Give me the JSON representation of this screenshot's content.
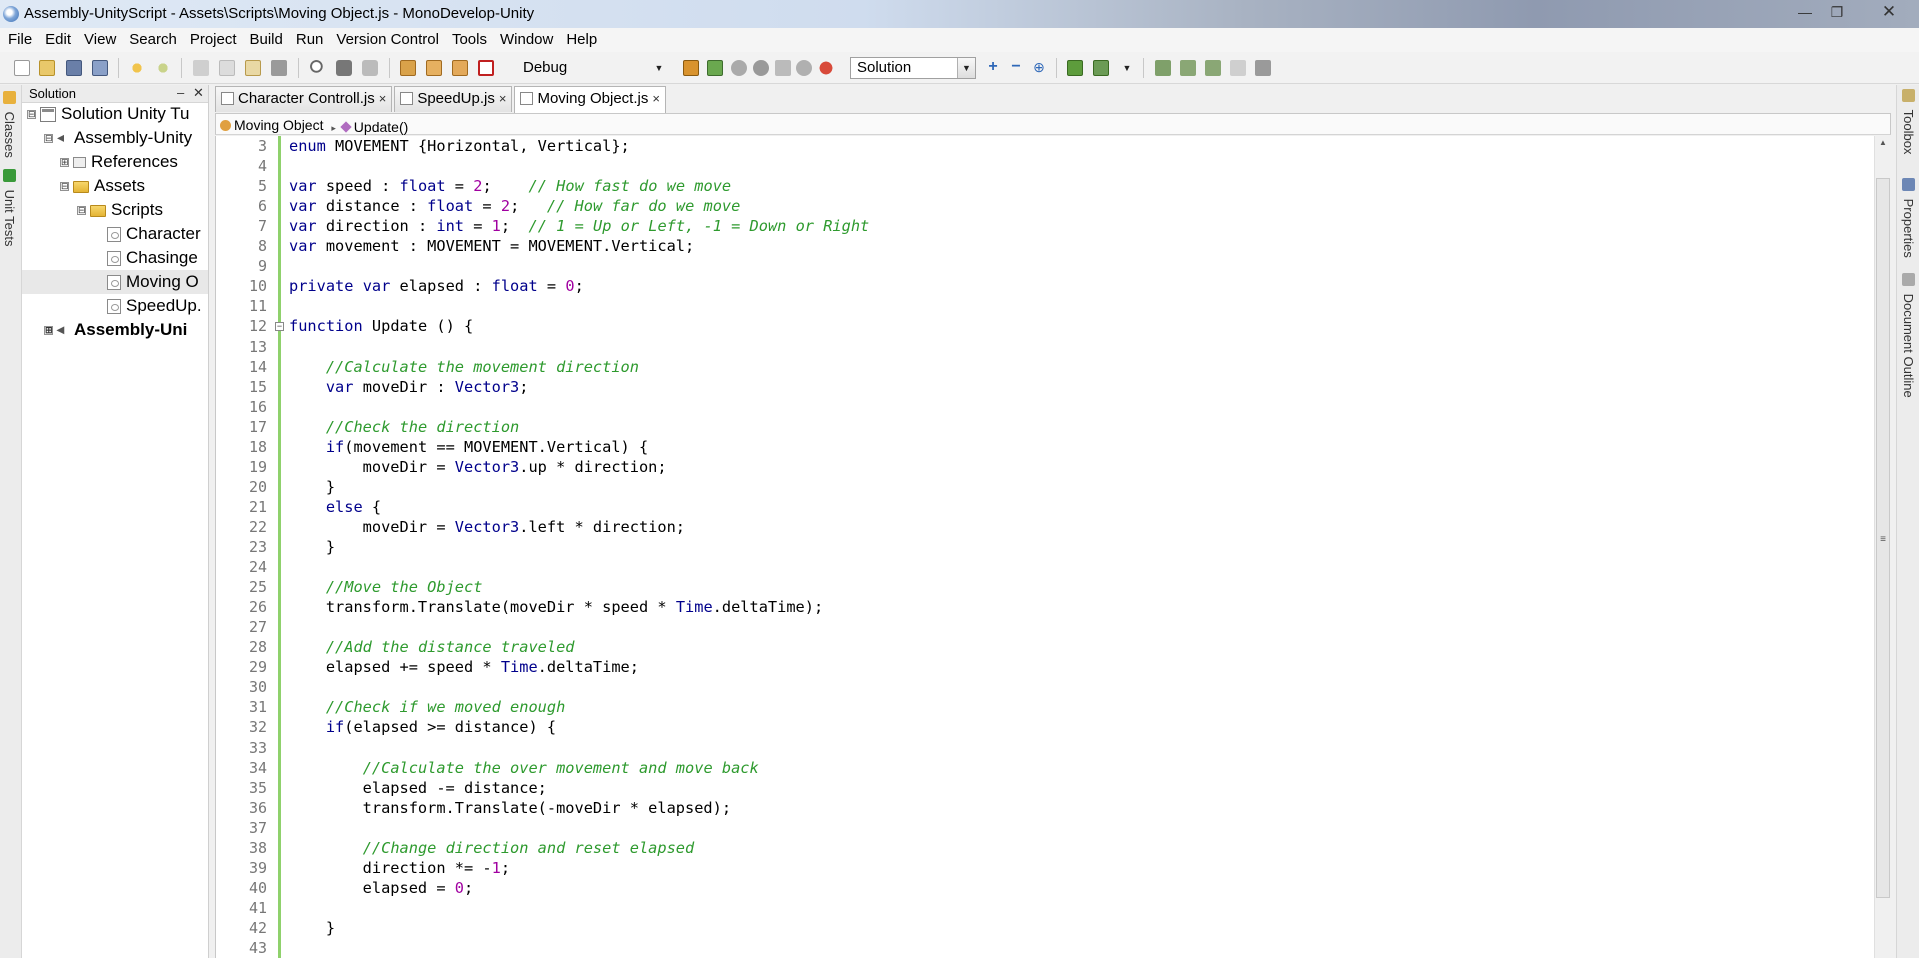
{
  "window": {
    "title": "Assembly-UnityScript - Assets\\Scripts\\Moving Object.js - MonoDevelop-Unity",
    "minimize": "—",
    "restore": "❐",
    "close": "✕"
  },
  "menu": [
    "File",
    "Edit",
    "View",
    "Search",
    "Project",
    "Build",
    "Run",
    "Version Control",
    "Tools",
    "Window",
    "Help"
  ],
  "toolbar": {
    "configuration": "Debug",
    "solution_target": "Solution"
  },
  "left_dock": [
    "Classes",
    "Unit Tests"
  ],
  "right_dock": [
    "Toolbox",
    "Properties",
    "Document Outline"
  ],
  "solution_pad": {
    "title": "Solution",
    "collapse": "–",
    "close": "✕",
    "tree": [
      {
        "label": "Solution Unity Tu",
        "icon": "solution-icon",
        "expander": "⊟"
      },
      {
        "label": "Assembly-Unity",
        "icon": "assembly-icon",
        "expander": "⊟"
      },
      {
        "label": "References",
        "icon": "references-icon",
        "expander": "⊞"
      },
      {
        "label": "Assets",
        "icon": "folder-icon",
        "expander": "⊟"
      },
      {
        "label": "Scripts",
        "icon": "folder-icon",
        "expander": "⊟"
      },
      {
        "label": "Character",
        "icon": "script-file-icon"
      },
      {
        "label": "Chasinge",
        "icon": "script-file-icon"
      },
      {
        "label": "Moving O",
        "icon": "script-file-icon"
      },
      {
        "label": "SpeedUp.",
        "icon": "script-file-icon"
      },
      {
        "label": "Assembly-Uni",
        "icon": "assembly-icon",
        "expander": "⊞"
      }
    ]
  },
  "tabs": [
    {
      "label": "Character Controll.js",
      "close": "×"
    },
    {
      "label": "SpeedUp.js",
      "close": "×"
    },
    {
      "label": "Moving Object.js",
      "close": "×",
      "active": true
    }
  ],
  "breadcrumb": {
    "class": "Moving Object",
    "separator": "▸",
    "method": "Update()"
  },
  "code": {
    "line_numbers": [
      "3",
      "4",
      "5",
      "6",
      "7",
      "8",
      "9",
      "10",
      "11",
      "12",
      "13",
      "14",
      "15",
      "16",
      "17",
      "18",
      "19",
      "20",
      "21",
      "22",
      "23",
      "24",
      "25",
      "26",
      "27",
      "28",
      "29",
      "30",
      "31",
      "32",
      "33",
      "34",
      "35",
      "36",
      "37",
      "38",
      "39",
      "40",
      "41",
      "42",
      "43"
    ],
    "fold_marker": "−",
    "lines": [
      "enum MOVEMENT {Horizontal, Vertical};",
      "",
      "var speed : float = 2;    // How fast do we move",
      "var distance : float = 2;   // How far do we move",
      "var direction : int = 1;  // 1 = Up or Left, -1 = Down or Right",
      "var movement : MOVEMENT = MOVEMENT.Vertical;",
      "",
      "private var elapsed : float = 0;",
      "",
      "function Update () {",
      "",
      "    //Calculate the movement direction",
      "    var moveDir : Vector3;",
      "",
      "    //Check the direction",
      "    if(movement == MOVEMENT.Vertical) {",
      "        moveDir = Vector3.up * direction;",
      "    }",
      "    else {",
      "        moveDir = Vector3.left * direction;",
      "    }",
      "",
      "    //Move the Object",
      "    transform.Translate(moveDir * speed * Time.deltaTime);",
      "",
      "    //Add the distance traveled",
      "    elapsed += speed * Time.deltaTime;",
      "",
      "    //Check if we moved enough",
      "    if(elapsed >= distance) {",
      "",
      "        //Calculate the over movement and move back",
      "        elapsed -= distance;",
      "        transform.Translate(-moveDir * elapsed);",
      "",
      "        //Change direction and reset elapsed",
      "        direction *= -1;",
      "        elapsed = 0;",
      "",
      "    }",
      ""
    ]
  },
  "colors": {
    "keyword": "#00008b",
    "number": "#a000a0",
    "comment": "#2e9a2e",
    "change_bar": "#8fd16c"
  }
}
